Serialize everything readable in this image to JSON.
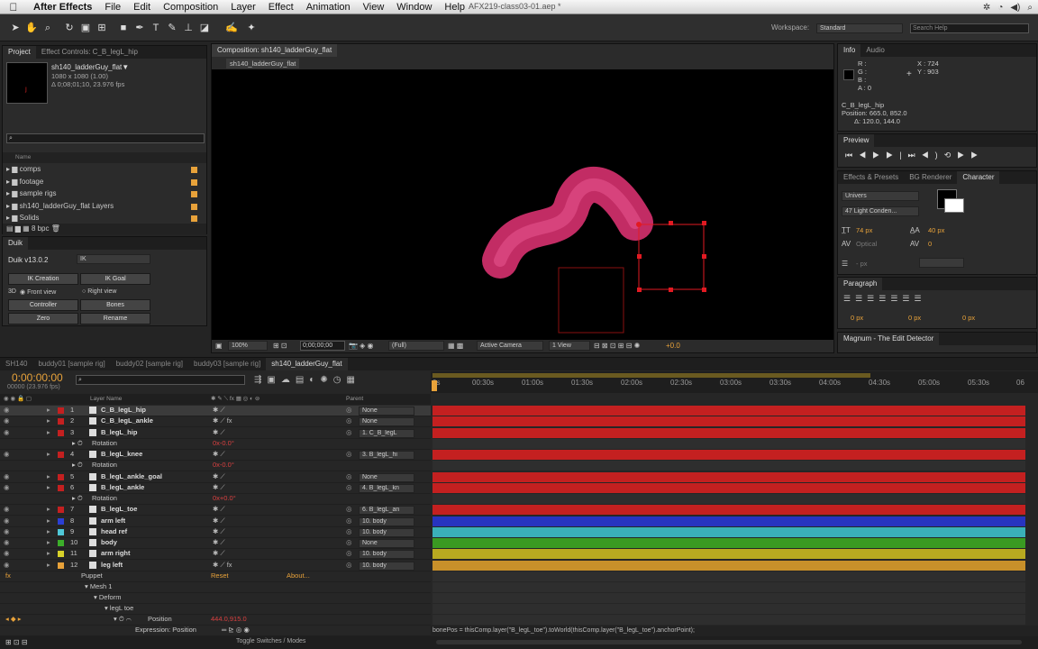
{
  "menubar": {
    "app_name": "After Effects",
    "items": [
      "File",
      "Edit",
      "Composition",
      "Layer",
      "Effect",
      "Animation",
      "View",
      "Window",
      "Help"
    ],
    "window_title": "AFX219-class03-01.aep *"
  },
  "toolbar": {
    "workspace_label": "Workspace:",
    "workspace_value": "Standard",
    "search_placeholder": "Search Help"
  },
  "project_panel": {
    "tabs": [
      "Project",
      "Effect Controls: C_B_legL_hip"
    ],
    "comp_name": "sh140_ladderGuy_flat▼",
    "comp_size": "1080 x 1080 (1.00)",
    "comp_duration": "Δ 0;08;01;10, 23.976 fps",
    "column_name": "Name",
    "items": [
      {
        "label": "comps",
        "color": "#e8a23a"
      },
      {
        "label": "footage",
        "color": "#e8a23a"
      },
      {
        "label": "sample rigs",
        "color": "#e8a23a"
      },
      {
        "label": "sh140_ladderGuy_flat Layers",
        "color": "#e8a23a"
      },
      {
        "label": "Solids",
        "color": "#e8a23a"
      }
    ],
    "bpc": "8 bpc"
  },
  "duik_panel": {
    "tab": "Duik",
    "version": "Duik v13.0.2",
    "mode": "IK",
    "buttons": {
      "ik_creation": "IK Creation",
      "ik_goal": "IK Goal",
      "front_view": "Front view",
      "right_view": "Right view",
      "controller": "Controller",
      "bones": "Bones",
      "zero": "Zero",
      "rename": "Rename"
    },
    "label_3d": "3D"
  },
  "composition_panel": {
    "tab_label": "Composition: sh140_ladderGuy_flat",
    "subtab": "sh140_ladderGuy_flat",
    "zoom": "100%",
    "timecode": "0;00;00;00",
    "resolution": "(Full)",
    "camera": "Active Camera",
    "view": "1 View",
    "exposure": "+0.0"
  },
  "info_panel": {
    "tabs": [
      "Info",
      "Audio"
    ],
    "r": "R :",
    "g": "G :",
    "b": "B :",
    "a": "A :  0",
    "x": "X : 724",
    "y": "Y : 903",
    "layer": "C_B_legL_hip",
    "position": "Position: 665.0, 852.0",
    "delta": "Δ: 120.0, 144.0"
  },
  "preview_panel": {
    "tab": "Preview"
  },
  "effects_panel": {
    "tabs": [
      "Effects & Presets",
      "BG Renderer",
      "Character"
    ],
    "font": "Univers",
    "style": "47 Light Conden...",
    "font_size": "74 px",
    "leading": "40 px",
    "kerning": "Optical",
    "tracking": "0",
    "stroke": "- px"
  },
  "paragraph_panel": {
    "tab": "Paragraph",
    "indent1": "0 px",
    "indent2": "0 px",
    "indent3": "0 px"
  },
  "magnum_panel": {
    "tab": "Magnum - The Edit Detector"
  },
  "timeline": {
    "tabs": [
      "SH140",
      "buddy01 [sample rig]",
      "buddy02 [sample rig]",
      "buddy03 [sample rig]",
      "sh140_ladderGuy_flat"
    ],
    "timecode": "0:00:00:00",
    "frame_info": "00000 (23.976 fps)",
    "col_layer": "Layer Name",
    "col_parent": "Parent",
    "ruler": [
      "0s",
      "00:30s",
      "01:00s",
      "01:30s",
      "02:00s",
      "02:30s",
      "03:00s",
      "03:30s",
      "04:00s",
      "04:30s",
      "05:00s",
      "05:30s",
      "06"
    ],
    "layers": [
      {
        "num": "1",
        "name": "C_B_legL_hip",
        "parent": "None",
        "label": "#c42020",
        "bar": "#c42020",
        "fx": false
      },
      {
        "num": "2",
        "name": "C_B_legL_ankle",
        "parent": "None",
        "label": "#c42020",
        "bar": "#c42020",
        "fx": true
      },
      {
        "num": "3",
        "name": "B_legL_hip",
        "parent": "1. C_B_legL",
        "label": "#c42020",
        "bar": "#c42020",
        "fx": false
      },
      {
        "num": "",
        "name": "Rotation",
        "value": "0x-0.0°",
        "prop": true
      },
      {
        "num": "4",
        "name": "B_legL_knee",
        "parent": "3. B_legL_hi",
        "label": "#c42020",
        "bar": "#c42020",
        "fx": false
      },
      {
        "num": "",
        "name": "Rotation",
        "value": "0x-0.0°",
        "prop": true
      },
      {
        "num": "5",
        "name": "B_legL_ankle_goal",
        "parent": "None",
        "label": "#c42020",
        "bar": "#c42020",
        "fx": false
      },
      {
        "num": "6",
        "name": "B_legL_ankle",
        "parent": "4. B_legL_kn",
        "label": "#c42020",
        "bar": "#c42020",
        "fx": false
      },
      {
        "num": "",
        "name": "Rotation",
        "value": "0x+0.0°",
        "prop": true
      },
      {
        "num": "7",
        "name": "B_legL_toe",
        "parent": "6. B_legL_an",
        "label": "#c42020",
        "bar": "#c42020",
        "fx": false
      },
      {
        "num": "8",
        "name": "arm left",
        "parent": "10. body",
        "label": "#2b3fd4",
        "bar": "#2734c0",
        "fx": false
      },
      {
        "num": "9",
        "name": "head ref",
        "parent": "10. body",
        "label": "#4fc8d8",
        "bar": "#3ab0b8",
        "fx": false
      },
      {
        "num": "10",
        "name": "body",
        "parent": "None",
        "label": "#3cae2a",
        "bar": "#3a9a22",
        "fx": false
      },
      {
        "num": "11",
        "name": "arm right",
        "parent": "10. body",
        "label": "#d8d22a",
        "bar": "#b8aa20",
        "fx": false
      },
      {
        "num": "12",
        "name": "leg left",
        "parent": "10. body",
        "label": "#e8a23a",
        "bar": "#c8902a",
        "fx": true
      }
    ],
    "puppet": "Puppet",
    "reset": "Reset",
    "about": "About...",
    "mesh": "Mesh 1",
    "deform": "Deform",
    "pin": "legL toe",
    "position_label": "Position",
    "position_value": "444.0,915.0",
    "expression_label": "Expression: Position",
    "expression_text": "bonePos = thisComp.layer(\"B_legL_toe\").toWorld(thisComp.layer(\"B_legL_toe\").anchorPoint);",
    "toggle_label": "Toggle Switches / Modes"
  }
}
